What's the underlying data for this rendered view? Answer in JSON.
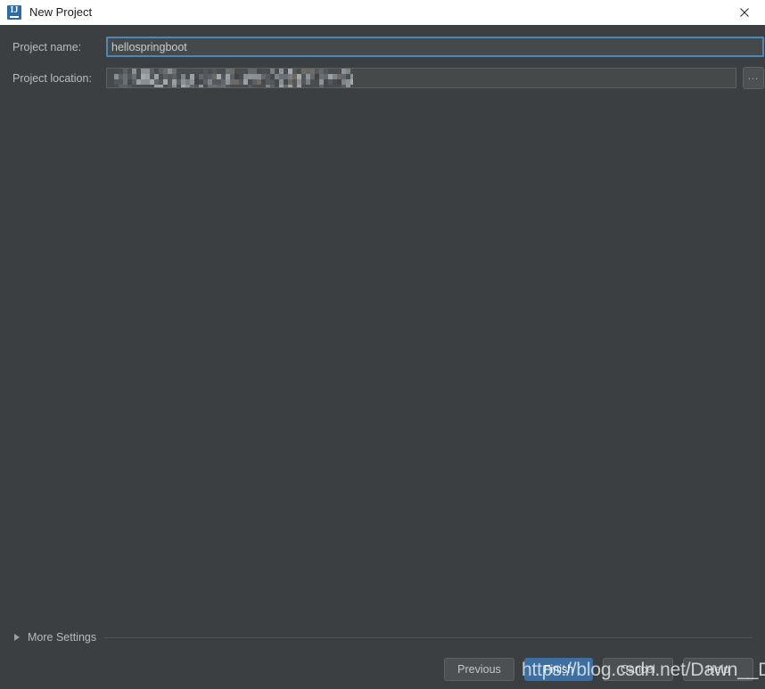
{
  "window": {
    "title": "New Project",
    "app_icon": "intellij-idea-icon",
    "close_icon": "close-icon",
    "titlebar_bg": "#ffffff",
    "body_bg": "#3c3f41"
  },
  "form": {
    "project_name": {
      "label": "Project name:",
      "value": "hellospringboot",
      "placeholder": ""
    },
    "project_location": {
      "label": "Project location:",
      "value": "",
      "redacted": true,
      "browse_button_label": "...",
      "browse_icon": "ellipsis-icon"
    }
  },
  "more_settings": {
    "label": "More Settings",
    "expanded": false,
    "arrow_icon": "chevron-right-icon"
  },
  "footer": {
    "buttons": [
      {
        "label": "Previous",
        "primary": false
      },
      {
        "label": "Finish",
        "primary": true
      },
      {
        "label": "Cancel",
        "primary": false
      },
      {
        "label": "Help",
        "primary": false
      }
    ],
    "primary_color": "#3c6e9f"
  },
  "watermark": {
    "text": "https://blog.csdn.net/Dawn__Dawn"
  }
}
